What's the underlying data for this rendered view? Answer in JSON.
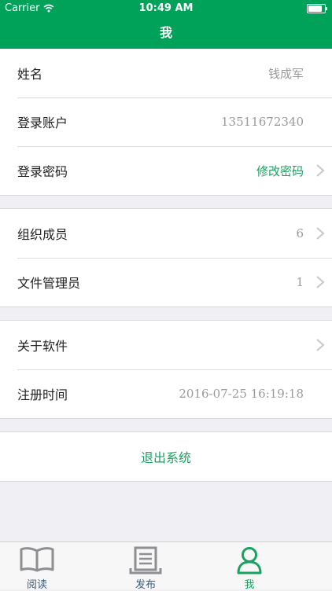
{
  "status_bar": {
    "carrier": "Carrier",
    "time": "10:49 AM",
    "battery_level": 0.95
  },
  "nav": {
    "title": "我"
  },
  "profile": {
    "name_label": "姓名",
    "name_value": "钱成军",
    "account_label": "登录账户",
    "account_value": "13511672340",
    "password_label": "登录密码",
    "password_action": "修改密码"
  },
  "org": {
    "members_label": "组织成员",
    "members_value": "6",
    "file_admin_label": "文件管理员",
    "file_admin_value": "1"
  },
  "about": {
    "about_label": "关于软件",
    "register_label": "注册时间",
    "register_value": "2016-07-25 16:19:18"
  },
  "logout": {
    "label": "退出系统"
  },
  "tabs": [
    {
      "label": "阅读",
      "icon": "book-icon",
      "active": false
    },
    {
      "label": "发布",
      "icon": "document-icon",
      "active": false
    },
    {
      "label": "我",
      "icon": "person-icon",
      "active": true
    }
  ],
  "colors": {
    "brand": "#00a25a",
    "accent": "#1aa160",
    "tab_inactive": "#3b5e78"
  }
}
